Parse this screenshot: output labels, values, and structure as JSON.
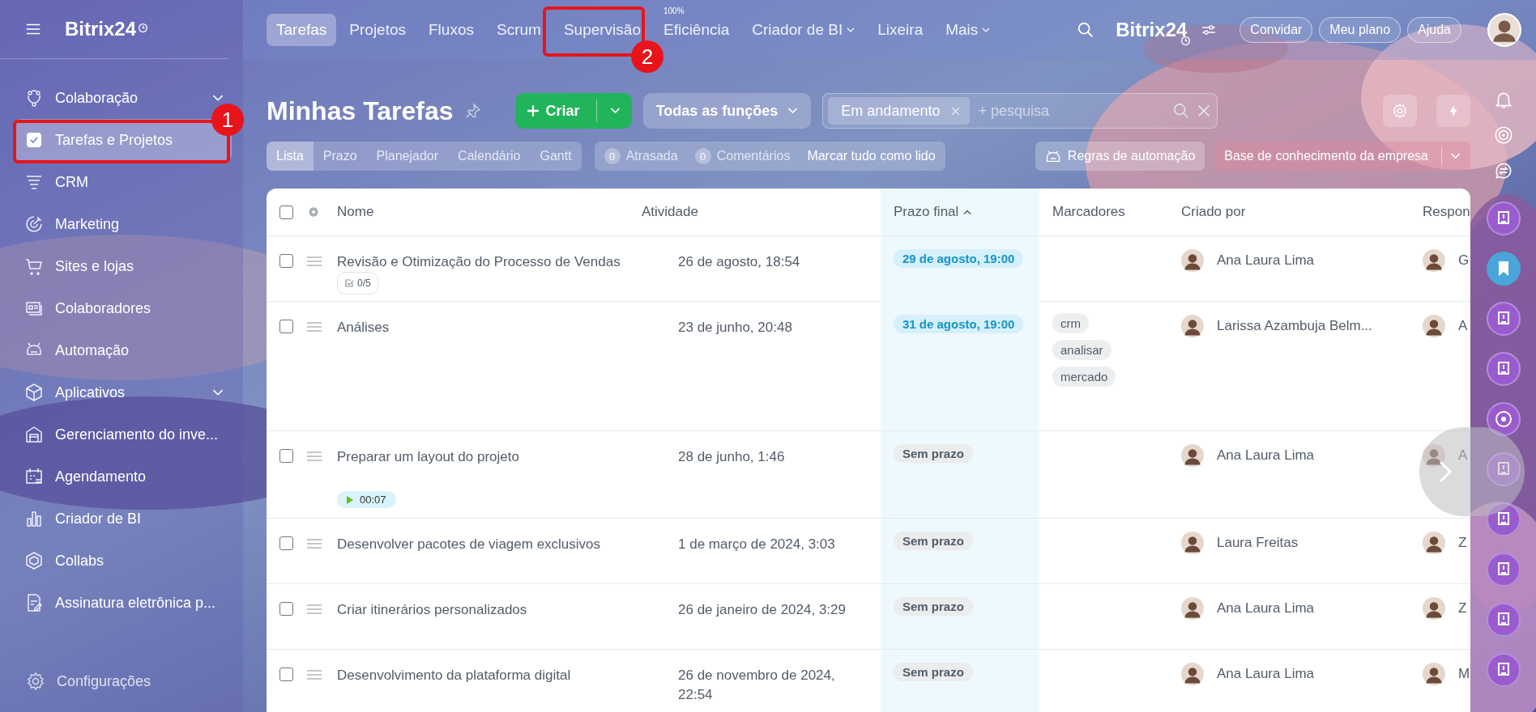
{
  "sidebar": {
    "logo": "Bitrix24",
    "items": [
      {
        "label": "Colaboração",
        "expandable": true,
        "selected": false
      },
      {
        "label": "Tarefas e Projetos",
        "expandable": false,
        "selected": true
      },
      {
        "label": "CRM",
        "expandable": false,
        "selected": false
      },
      {
        "label": "Marketing",
        "expandable": false,
        "selected": false
      },
      {
        "label": "Sites e lojas",
        "expandable": false,
        "selected": false
      },
      {
        "label": "Colaboradores",
        "expandable": false,
        "selected": false
      },
      {
        "label": "Automação",
        "expandable": false,
        "selected": false
      },
      {
        "label": "Aplicativos",
        "expandable": true,
        "selected": false
      },
      {
        "label": "Gerenciamento do inve...",
        "expandable": false,
        "selected": false
      },
      {
        "label": "Agendamento",
        "expandable": false,
        "selected": false
      },
      {
        "label": "Criador de BI",
        "expandable": false,
        "selected": false
      },
      {
        "label": "Collabs",
        "expandable": false,
        "selected": false
      },
      {
        "label": "Assinatura eletrônica p...",
        "expandable": false,
        "selected": false
      }
    ],
    "settings": "Configurações"
  },
  "annotations": [
    {
      "number": "1"
    },
    {
      "number": "2"
    }
  ],
  "top_nav": {
    "tabs": [
      {
        "label": "Tarefas",
        "selected": true,
        "dropdown": false
      },
      {
        "label": "Projetos",
        "selected": false,
        "dropdown": false
      },
      {
        "label": "Fluxos",
        "selected": false,
        "dropdown": false
      },
      {
        "label": "Scrum",
        "selected": false,
        "dropdown": false
      },
      {
        "label": "Supervisão",
        "selected": false,
        "dropdown": false
      },
      {
        "label": "Eficiência",
        "selected": false,
        "dropdown": false,
        "badge": "100%"
      },
      {
        "label": "Criador de BI",
        "selected": false,
        "dropdown": true
      },
      {
        "label": "Lixeira",
        "selected": false,
        "dropdown": false
      },
      {
        "label": "Mais",
        "selected": false,
        "dropdown": true
      }
    ],
    "brand": "Bitrix24",
    "buttons": [
      "Convidar",
      "Meu plano",
      "Ajuda"
    ]
  },
  "header": {
    "title": "Minhas Tarefas",
    "create": "Criar",
    "role_filter": "Todas as funções",
    "search": {
      "chip": "Em andamento",
      "placeholder": "+ pesquisa"
    }
  },
  "toolbar": {
    "views": [
      {
        "label": "Lista",
        "selected": true
      },
      {
        "label": "Prazo",
        "selected": false
      },
      {
        "label": "Planejador",
        "selected": false
      },
      {
        "label": "Calendário",
        "selected": false
      },
      {
        "label": "Gantt",
        "selected": false
      }
    ],
    "counters": [
      {
        "count": "0",
        "label": "Atrasada"
      },
      {
        "count": "0",
        "label": "Comentários"
      }
    ],
    "mark_read": "Marcar tudo como lido",
    "automation": "Regras de automação",
    "knowledge": "Base de conhecimento da empresa"
  },
  "table": {
    "all_checked": false,
    "columns": [
      {
        "label": "Nome",
        "sorted": false
      },
      {
        "label": "Atividade",
        "sorted": false
      },
      {
        "label": "Prazo final",
        "sorted": true
      },
      {
        "label": "Marcadores",
        "sorted": false
      },
      {
        "label": "Criado por",
        "sorted": false
      },
      {
        "label": "Respon",
        "sorted": false
      }
    ],
    "rows": [
      {
        "checked": false,
        "name": "Revisão e Otimização do Processo de Vendas",
        "checklist": "0/5",
        "activity": "26 de agosto, 18:54",
        "deadline": {
          "kind": "date",
          "text": "29 de agosto, 19:00"
        },
        "tags": [],
        "creator": "Ana Laura Lima",
        "responsible": "G"
      },
      {
        "checked": false,
        "name": "Análises",
        "activity": "23 de junho, 20:48",
        "deadline": {
          "kind": "date",
          "text": "31 de agosto, 19:00"
        },
        "tags": [
          "crm",
          "analisar",
          "mercado"
        ],
        "creator": "Larissa Azambuja Belm...",
        "responsible": "A"
      },
      {
        "checked": false,
        "name": "Preparar um layout do projeto",
        "timer": "00:07",
        "activity": "28 de junho, 1:46",
        "deadline": {
          "kind": "none",
          "text": "Sem prazo"
        },
        "tags": [],
        "creator": "Ana Laura Lima",
        "responsible": "A"
      },
      {
        "checked": false,
        "name": "Desenvolver pacotes de viagem exclusivos",
        "activity": "1 de março de 2024, 3:03",
        "deadline": {
          "kind": "none",
          "text": "Sem prazo"
        },
        "tags": [],
        "creator": "Laura Freitas",
        "responsible": "Z"
      },
      {
        "checked": false,
        "name": "Criar itinerários personalizados",
        "activity": "26 de janeiro de 2024, 3:29",
        "deadline": {
          "kind": "none",
          "text": "Sem prazo"
        },
        "tags": [],
        "creator": "Ana Laura Lima",
        "responsible": "Z"
      },
      {
        "checked": false,
        "name": "Desenvolvimento da plataforma digital",
        "activity": "26 de novembro de 2024, 22:54",
        "deadline": {
          "kind": "none",
          "text": "Sem prazo"
        },
        "tags": [],
        "creator": "Ana Laura Lima",
        "responsible": "M"
      }
    ]
  }
}
